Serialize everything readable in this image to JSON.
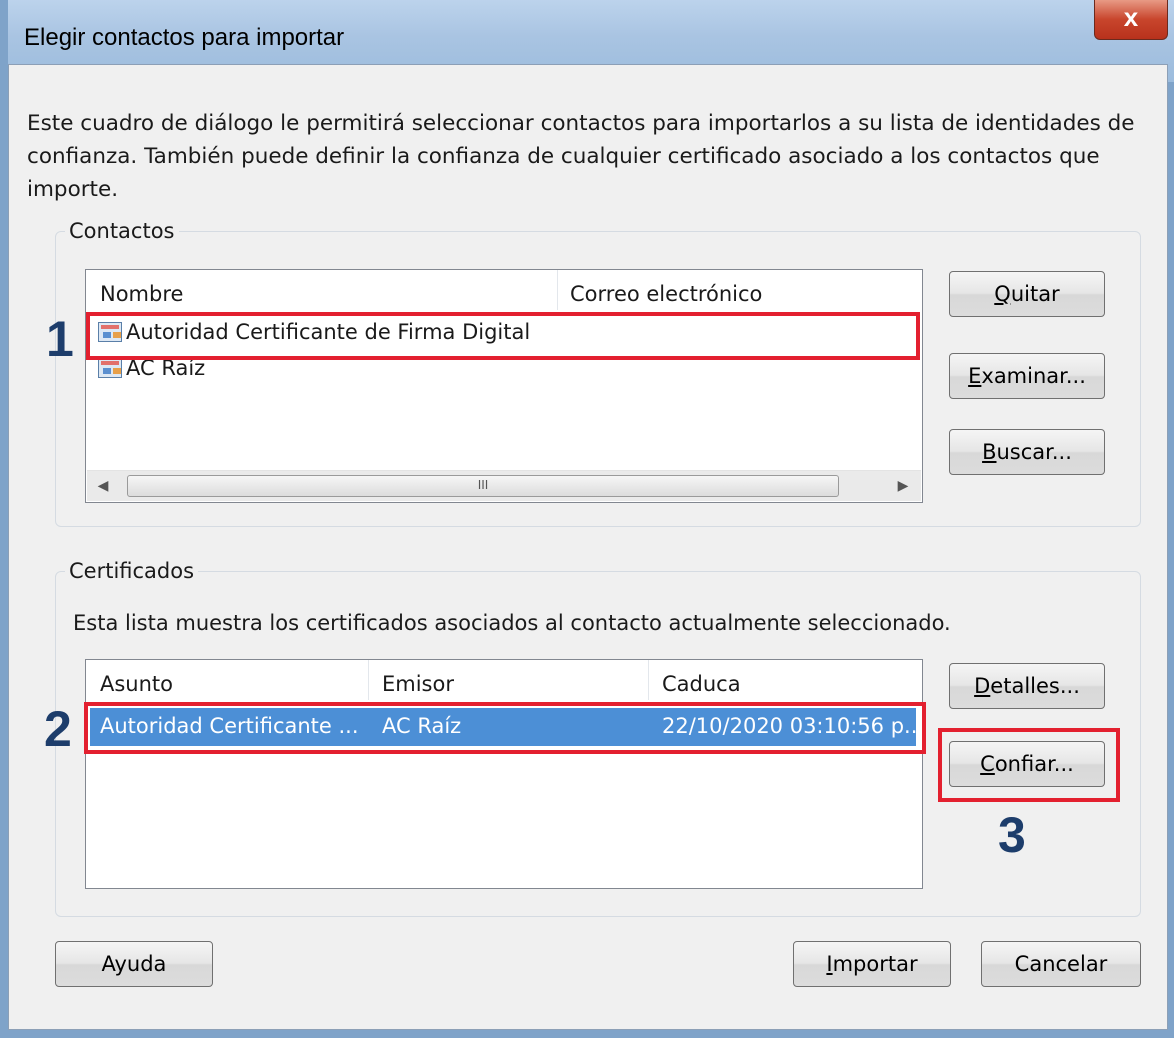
{
  "window": {
    "title": "Elegir contactos para importar",
    "close_glyph": "x",
    "intro": "Este cuadro de diálogo le permitirá seleccionar contactos para importarlos a su lista de identidades de confianza. También puede definir la confianza de cualquier certificado asociado a los contactos que importe."
  },
  "contactos": {
    "legend": "Contactos",
    "columns": [
      "Nombre",
      "Correo electrónico"
    ],
    "rows": [
      {
        "name": "Autoridad Certificante de Firma Digital",
        "email": ""
      },
      {
        "name": "AC Raíz",
        "email": ""
      }
    ],
    "scroll_left": "◀",
    "scroll_right": "▶",
    "scroll_grip": "III",
    "buttons": {
      "quitar": {
        "accel": "Q",
        "rest": "uitar"
      },
      "examinar": {
        "accel": "E",
        "rest": "xaminar..."
      },
      "buscar": {
        "accel": "B",
        "rest": "uscar..."
      }
    }
  },
  "certificados": {
    "legend": "Certificados",
    "description": "Esta lista muestra los certificados asociados al contacto actualmente seleccionado.",
    "columns": [
      "Asunto",
      "Emisor",
      "Caduca"
    ],
    "rows": [
      {
        "asunto": "Autoridad Certificante ...",
        "emisor": "AC Raíz",
        "caduca": "22/10/2020 03:10:56 p...",
        "selected": true
      }
    ],
    "buttons": {
      "detalles": {
        "accel": "D",
        "rest": "etalles..."
      },
      "confiar": {
        "accel": "C",
        "rest": "onfiar..."
      }
    }
  },
  "footer": {
    "ayuda": "Ayuda",
    "importar": {
      "pre": "",
      "accel": "I",
      "rest": "mportar"
    },
    "cancelar": "Cancelar"
  },
  "annotations": {
    "marker1": "1",
    "marker2": "2",
    "marker3": "3",
    "highlight_color": "#e3202f",
    "marker_color": "#1d3d6b"
  },
  "colors": {
    "selection": "#4c8fd6",
    "dialog_bg": "#f0f0f0",
    "titlebar": "#a9c4e2"
  }
}
